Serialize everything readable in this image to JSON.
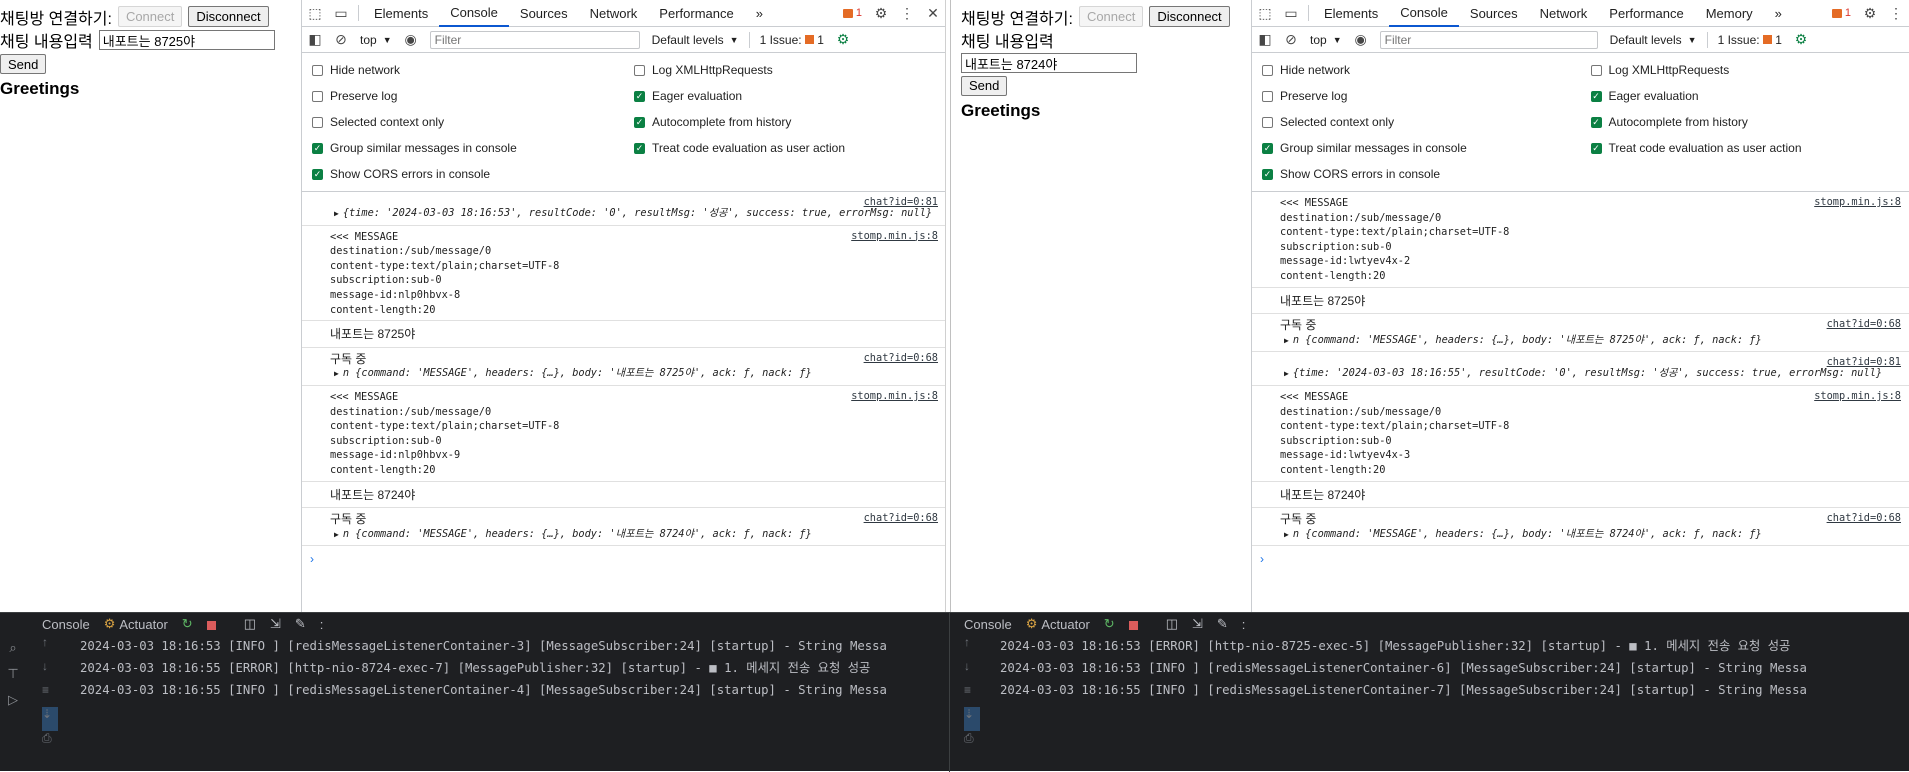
{
  "left": {
    "page": {
      "connect_label": "채팅방 연결하기:",
      "connect_button": "Connect",
      "disconnect_button": "Disconnect",
      "input_label": "채팅 내용입력",
      "input_value": "내포트는 8725야",
      "send_button": "Send",
      "greetings": "Greetings"
    },
    "devtools": {
      "tabs": [
        "Elements",
        "Console",
        "Sources",
        "Network",
        "Performance"
      ],
      "active_tab": "Console",
      "more_tabs": "»",
      "error_count": "1",
      "context": "top",
      "filter_placeholder": "Filter",
      "levels": "Default levels",
      "issues_label": "1 Issue:",
      "issues_count": "1",
      "settings_left": [
        {
          "label": "Hide network",
          "checked": false
        },
        {
          "label": "Preserve log",
          "checked": false
        },
        {
          "label": "Selected context only",
          "checked": false
        },
        {
          "label": "Group similar messages in console",
          "checked": true
        },
        {
          "label": "Show CORS errors in console",
          "checked": true
        }
      ],
      "settings_right": [
        {
          "label": "Log XMLHttpRequests",
          "checked": false
        },
        {
          "label": "Eager evaluation",
          "checked": true
        },
        {
          "label": "Autocomplete from history",
          "checked": true
        },
        {
          "label": "Treat code evaluation as user action",
          "checked": true
        }
      ],
      "console": [
        {
          "kind": "object",
          "source": "chat?id=0:81",
          "lead": "",
          "object": "{time: '2024-03-03 18:16:53', resultCode: '0', resultMsg: '성공', success: true, errorMsg: null}"
        },
        {
          "kind": "stomp",
          "source": "stomp.min.js:8",
          "lines": [
            "<<< MESSAGE",
            "destination:/sub/message/0",
            "content-type:text/plain;charset=UTF-8",
            "subscription:sub-0",
            "message-id:nlp0hbvx-8",
            "content-length:20"
          ]
        },
        {
          "kind": "plain",
          "text": "내포트는 8725야"
        },
        {
          "kind": "object",
          "source": "chat?id=0:68",
          "lead": "구독 중",
          "object": "n {command: 'MESSAGE', headers: {…}, body: '내포트는 8725야', ack: ƒ, nack: ƒ}"
        },
        {
          "kind": "stomp",
          "source": "stomp.min.js:8",
          "lines": [
            "<<< MESSAGE",
            "destination:/sub/message/0",
            "content-type:text/plain;charset=UTF-8",
            "subscription:sub-0",
            "message-id:nlp0hbvx-9",
            "content-length:20"
          ]
        },
        {
          "kind": "plain",
          "text": "내포트는 8724야"
        },
        {
          "kind": "object",
          "source": "chat?id=0:68",
          "lead": "구독 중",
          "object": "n {command: 'MESSAGE', headers: {…}, body: '내포트는 8724야', ack: ƒ, nack: ƒ}"
        }
      ]
    },
    "ide": {
      "tabs": [
        "Console",
        "Actuator"
      ],
      "logs": [
        "2024-03-03 18:16:53 [INFO ] [redisMessageListenerContainer-3] [MessageSubscriber:24] [startup] - String Messa",
        "2024-03-03 18:16:55 [ERROR] [http-nio-8724-exec-7] [MessagePublisher:32] [startup] - ■ 1. 메세지 전송 요청 성공",
        "2024-03-03 18:16:55 [INFO ] [redisMessageListenerContainer-4] [MessageSubscriber:24] [startup] - String Messa"
      ]
    }
  },
  "right": {
    "page": {
      "connect_label": "채팅방 연결하기:",
      "connect_button": "Connect",
      "disconnect_button": "Disconnect",
      "input_label": "채팅 내용입력",
      "input_value": "내포트는 8724야",
      "send_button": "Send",
      "greetings": "Greetings"
    },
    "devtools": {
      "tabs": [
        "Elements",
        "Console",
        "Sources",
        "Network",
        "Performance",
        "Memory"
      ],
      "active_tab": "Console",
      "more_tabs": "»",
      "error_count": "1",
      "context": "top",
      "filter_placeholder": "Filter",
      "levels": "Default levels",
      "issues_label": "1 Issue:",
      "issues_count": "1",
      "settings_left": [
        {
          "label": "Hide network",
          "checked": false
        },
        {
          "label": "Preserve log",
          "checked": false
        },
        {
          "label": "Selected context only",
          "checked": false
        },
        {
          "label": "Group similar messages in console",
          "checked": true
        },
        {
          "label": "Show CORS errors in console",
          "checked": true
        }
      ],
      "settings_right": [
        {
          "label": "Log XMLHttpRequests",
          "checked": false
        },
        {
          "label": "Eager evaluation",
          "checked": true
        },
        {
          "label": "Autocomplete from history",
          "checked": true
        },
        {
          "label": "Treat code evaluation as user action",
          "checked": true
        }
      ],
      "console": [
        {
          "kind": "stomp",
          "source": "stomp.min.js:8",
          "lines": [
            "<<< MESSAGE",
            "destination:/sub/message/0",
            "content-type:text/plain;charset=UTF-8",
            "subscription:sub-0",
            "message-id:lwtyev4x-2",
            "content-length:20"
          ]
        },
        {
          "kind": "plain",
          "text": "내포트는 8725야"
        },
        {
          "kind": "object",
          "source": "chat?id=0:68",
          "lead": "구독 중",
          "object": "n {command: 'MESSAGE', headers: {…}, body: '내포트는 8725야', ack: ƒ, nack: ƒ}"
        },
        {
          "kind": "object",
          "source": "chat?id=0:81",
          "lead": "",
          "object": "{time: '2024-03-03 18:16:55', resultCode: '0', resultMsg: '성공', success: true, errorMsg: null}"
        },
        {
          "kind": "stomp",
          "source": "stomp.min.js:8",
          "lines": [
            "<<< MESSAGE",
            "destination:/sub/message/0",
            "content-type:text/plain;charset=UTF-8",
            "subscription:sub-0",
            "message-id:lwtyev4x-3",
            "content-length:20"
          ]
        },
        {
          "kind": "plain",
          "text": "내포트는 8724야"
        },
        {
          "kind": "object",
          "source": "chat?id=0:68",
          "lead": "구독 중",
          "object": "n {command: 'MESSAGE', headers: {…}, body: '내포트는 8724야', ack: ƒ, nack: ƒ}"
        }
      ]
    },
    "ide": {
      "tabs": [
        "Console",
        "Actuator"
      ],
      "logs": [
        "2024-03-03 18:16:53 [ERROR] [http-nio-8725-exec-5] [MessagePublisher:32] [startup] - ■ 1. 메세지 전송 요청 성공",
        "2024-03-03 18:16:53 [INFO ] [redisMessageListenerContainer-6] [MessageSubscriber:24] [startup] - String Messa",
        "2024-03-03 18:16:55 [INFO ] [redisMessageListenerContainer-7] [MessageSubscriber:24] [startup] - String Messa"
      ]
    }
  },
  "colors": {
    "active_tab_underline": "#0b57d0",
    "string_value": "#c80000",
    "checkbox_on": "#0b8043",
    "error_badge": "#e46b25",
    "ide_background": "#1e1f22"
  }
}
